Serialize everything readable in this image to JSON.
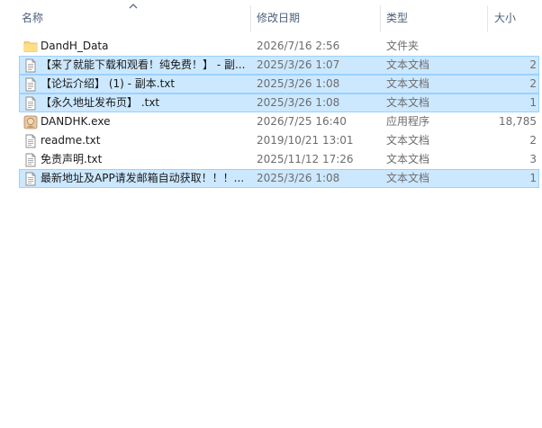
{
  "columns": {
    "name": "名称",
    "date": "修改日期",
    "type": "类型",
    "size": "大小"
  },
  "sort": {
    "column": "name",
    "direction": "ascending",
    "icon": "sort-up-chevron-icon"
  },
  "colors": {
    "selected_bg": "#cce8ff",
    "selected_border": "#99d1ff",
    "folder": "#f8d775",
    "header_text": "#4c607a"
  },
  "files": [
    {
      "name": "DandH_Data",
      "date": "2026/7/16 2:56",
      "type": "文件夹",
      "size": "",
      "icon": "folder-icon",
      "selected": false
    },
    {
      "name": "【来了就能下载和观看！纯免费！】 - 副...",
      "date": "2025/3/26 1:07",
      "type": "文本文档",
      "size": "2",
      "icon": "text-document-icon",
      "selected": true
    },
    {
      "name": "【论坛介绍】 (1) - 副本.txt",
      "date": "2025/3/26 1:08",
      "type": "文本文档",
      "size": "2",
      "icon": "text-document-icon",
      "selected": true
    },
    {
      "name": "【永久地址发布页】 .txt",
      "date": "2025/3/26 1:08",
      "type": "文本文档",
      "size": "1",
      "icon": "text-document-icon",
      "selected": true
    },
    {
      "name": "DANDHK.exe",
      "date": "2026/7/25 16:40",
      "type": "应用程序",
      "size": "18,785",
      "icon": "application-icon",
      "selected": false
    },
    {
      "name": "readme.txt",
      "date": "2019/10/21 13:01",
      "type": "文本文档",
      "size": "2",
      "icon": "text-document-icon",
      "selected": false
    },
    {
      "name": "免责声明.txt",
      "date": "2025/11/12 17:26",
      "type": "文本文档",
      "size": "3",
      "icon": "text-document-icon",
      "selected": false
    },
    {
      "name": "最新地址及APP请发邮箱自动获取！！！...",
      "date": "2025/3/26 1:08",
      "type": "文本文档",
      "size": "1",
      "icon": "text-document-icon",
      "selected": true
    }
  ]
}
